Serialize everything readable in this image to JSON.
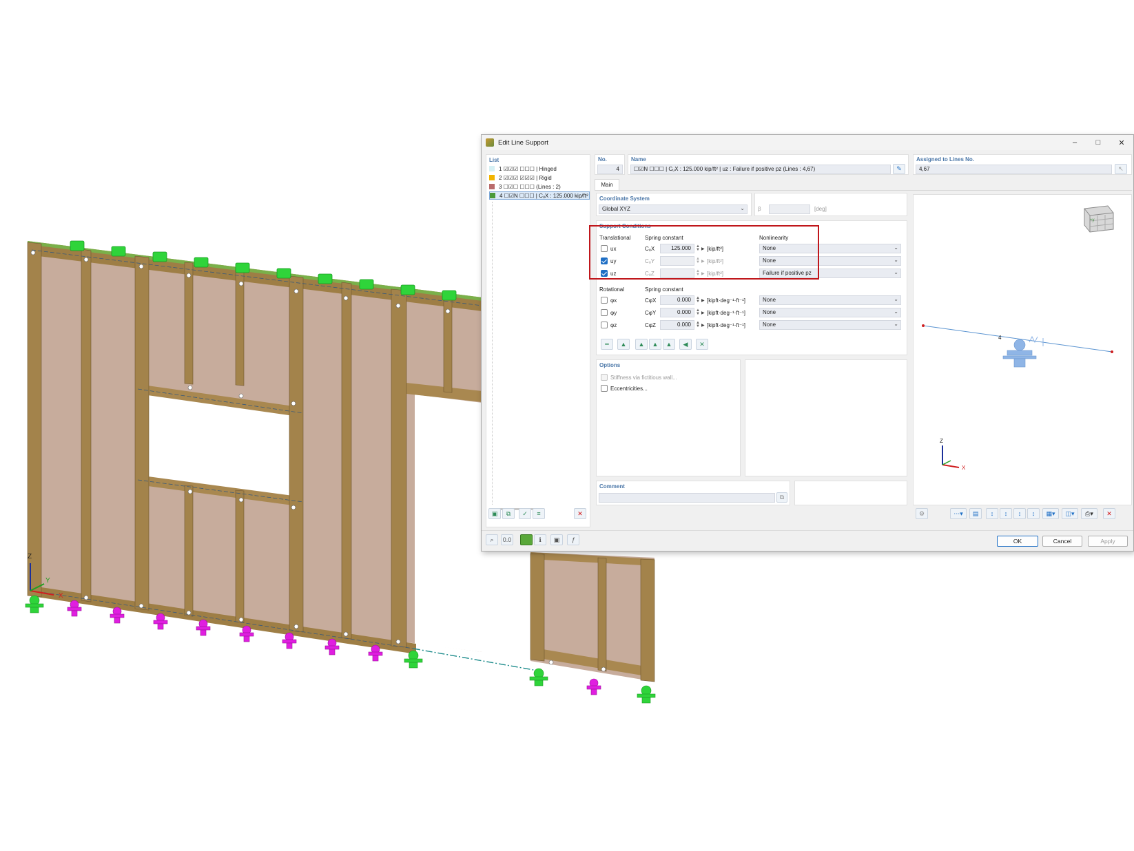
{
  "dialog": {
    "title": "Edit Line Support",
    "window_buttons": {
      "minimize": "–",
      "maximize": "□",
      "close": "✕"
    }
  },
  "list": {
    "header": "List",
    "items": [
      {
        "no": "1",
        "label": "☑☑☑ ☐☐☐ | Hinged",
        "color": "#d6f0f4"
      },
      {
        "no": "2",
        "label": "☑☑☑ ☑☑☑ | Rigid",
        "color": "#f2b400"
      },
      {
        "no": "3",
        "label": "☐☑☐ ☐☐☐ (Lines : 2)",
        "color": "#b96b6b"
      },
      {
        "no": "4",
        "label": "☐☑N ☐☐☐ | CᵤX : 125.000 kip/ft²",
        "color": "#4a9a3a"
      }
    ]
  },
  "no": {
    "label": "No.",
    "value": "4"
  },
  "name": {
    "label": "Name",
    "value": "☐☑N ☐☐☐ | CᵤX : 125.000 kip/ft² | uz : Failure if positive pz (Lines : 4,67)"
  },
  "assigned": {
    "label": "Assigned to Lines No.",
    "value": "4,67"
  },
  "tabs": {
    "main": "Main"
  },
  "coordinate_system": {
    "header": "Coordinate System",
    "value": "Global XYZ",
    "beta_label": "β",
    "beta_unit": "[deg]"
  },
  "support_conditions": {
    "header": "Support Conditions",
    "translational_label": "Translational",
    "spring_label": "Spring constant",
    "nonlinearity_label": "Nonlinearity",
    "translational": [
      {
        "dof": "ux",
        "checked": false,
        "const": "CᵤX",
        "value": "125.000",
        "unit": "[kip/ft²]",
        "nonlinearity": "None"
      },
      {
        "dof": "uy",
        "checked": true,
        "const": "CᵤY",
        "value": "",
        "unit": "[kip/ft²]",
        "nonlinearity": "None"
      },
      {
        "dof": "uz",
        "checked": true,
        "const": "CᵤZ",
        "value": "",
        "unit": "[kip/ft²]",
        "nonlinearity": "Failure if positive pz"
      }
    ],
    "rotational_label": "Rotational",
    "rot_spring_label": "Spring constant",
    "rotational": [
      {
        "dof": "φx",
        "checked": false,
        "const": "CφX",
        "value": "0.000",
        "unit": "[kipft·deg⁻¹·ft⁻¹]",
        "nonlinearity": "None"
      },
      {
        "dof": "φy",
        "checked": false,
        "const": "CφY",
        "value": "0.000",
        "unit": "[kipft·deg⁻¹·ft⁻¹]",
        "nonlinearity": "None"
      },
      {
        "dof": "φz",
        "checked": false,
        "const": "CφZ",
        "value": "0.000",
        "unit": "[kipft·deg⁻¹·ft⁻¹]",
        "nonlinearity": "None"
      }
    ]
  },
  "options": {
    "header": "Options",
    "fictitious_wall": "Stiffness via fictitious wall...",
    "eccentricities": "Eccentricities..."
  },
  "comment": {
    "header": "Comment"
  },
  "preview": {
    "line_no": "4",
    "axis_x": "X",
    "axis_z": "Z",
    "cube_label": "+y"
  },
  "buttons": {
    "ok": "OK",
    "cancel": "Cancel",
    "apply": "Apply"
  },
  "model": {
    "axis_x": "X",
    "axis_y": "Y",
    "axis_z": "Z"
  },
  "colors": {
    "accent": "#1f6fc5",
    "highlight": "#c0161b",
    "support_green": "#2fd43a",
    "support_magenta": "#e01ee0",
    "timber": "#b08a4e",
    "sheathing": "#c9b0a0"
  }
}
